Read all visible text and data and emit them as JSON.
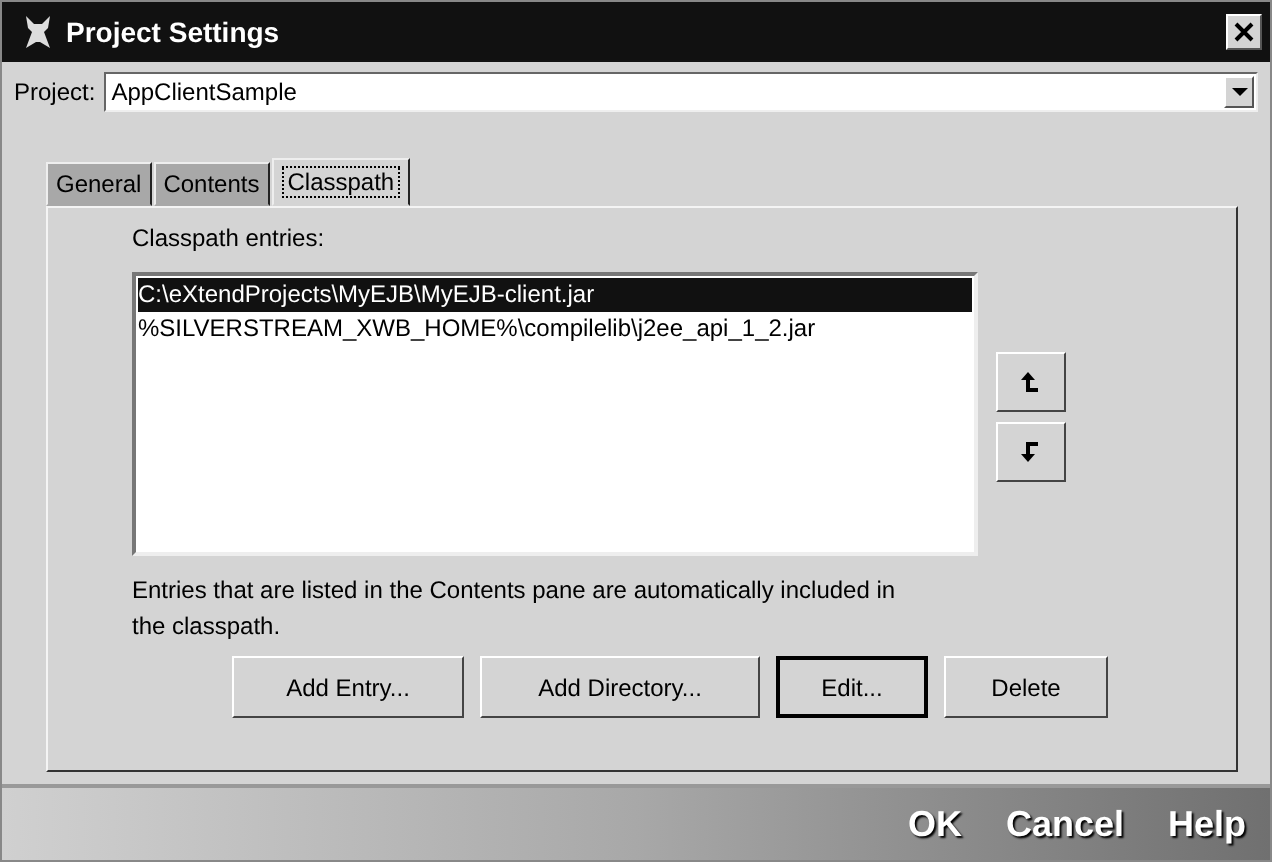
{
  "window": {
    "title": "Project Settings"
  },
  "project": {
    "label": "Project:",
    "value": "AppClientSample"
  },
  "tabs": [
    {
      "label": "General",
      "selected": false
    },
    {
      "label": "Contents",
      "selected": false
    },
    {
      "label": "Classpath",
      "selected": true
    }
  ],
  "classpath": {
    "label": "Classpath entries:",
    "entries": [
      {
        "text": "C:\\eXtendProjects\\MyEJB\\MyEJB-client.jar",
        "selected": true
      },
      {
        "text": "%SILVERSTREAM_XWB_HOME%\\compilelib\\j2ee_api_1_2.jar",
        "selected": false
      }
    ],
    "note": "Entries that are listed in the Contents pane are automatically included in the classpath.",
    "buttons": [
      {
        "label": "Add Entry...",
        "default": false
      },
      {
        "label": "Add Directory...",
        "default": false
      },
      {
        "label": "Edit...",
        "default": true
      },
      {
        "label": "Delete",
        "default": false
      }
    ]
  },
  "footer_buttons": [
    "OK",
    "Cancel",
    "Help"
  ]
}
